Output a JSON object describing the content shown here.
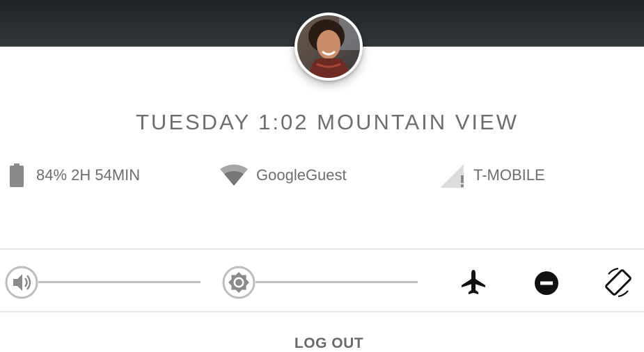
{
  "header": {
    "datetime": "TUESDAY 1:02 MOUNTAIN VIEW"
  },
  "status": {
    "battery": {
      "icon": "battery-icon",
      "text": "84% 2H 54MIN"
    },
    "wifi": {
      "icon": "wifi-icon",
      "text": "GoogleGuest"
    },
    "cellular": {
      "icon": "cellular-signal-icon",
      "text": "T-MOBILE"
    }
  },
  "quick_settings": {
    "volume_level": 0,
    "brightness_level": 0,
    "toggles": [
      "airplane-mode-icon",
      "do-not-disturb-icon",
      "auto-rotate-icon"
    ]
  },
  "footer": {
    "logout_label": "LOG OUT"
  },
  "colors": {
    "header": "#2b3133",
    "text": "#6e6e6e",
    "icon_dark": "#111111",
    "track": "#bdbdbd"
  }
}
